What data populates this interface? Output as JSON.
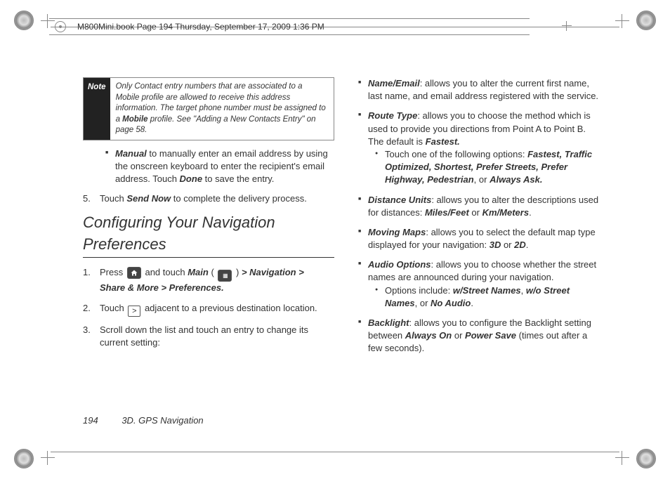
{
  "header": "M800Mini.book  Page 194  Thursday, September 17, 2009  1:36 PM",
  "note": {
    "label": "Note",
    "body_pre": "Only Contact entry numbers that are associated to a Mobile profile are allowed to receive this address information. The target phone number must be assigned to a ",
    "body_strong": "Mobile",
    "body_post": " profile. See \"Adding a New Contacts Entry\" on page 58."
  },
  "manual": {
    "label": "Manual",
    "text": " to manually enter an email address by using the onscreen keyboard to enter the recipient's email address. Touch ",
    "done": "Done",
    "text2": " to save the entry."
  },
  "step5": {
    "num": "5.",
    "pre": "Touch ",
    "bold": "Send Now",
    "post": " to complete the delivery process."
  },
  "sectionTitle": "Configuring Your Navigation Preferences",
  "step1": {
    "num": "1.",
    "p1": "Press ",
    "p2": " and touch ",
    "main": "Main",
    "paren_open": " ( ",
    "paren_close": " ) ",
    "gt1": ">",
    "nav": "Navigation",
    "gt2": ">",
    "share": "Share & More",
    "gt3": ">",
    "prefs": "Preferences."
  },
  "step2": {
    "num": "2.",
    "pre": "Touch ",
    "post": " adjacent to a previous destination location."
  },
  "step3": {
    "num": "3.",
    "text": "  Scroll down the list and touch an entry to change its current setting:"
  },
  "opts": {
    "name_email": {
      "label": "Name/Email",
      "text": ": allows you to alter the current first name, last name, and email address registered with the service."
    },
    "route": {
      "label": "Route Type",
      "text": ": allows you to choose the method which is used to provide you directions from Point A to Point B. The default is ",
      "def": "Fastest."
    },
    "route_bullet_pre": "Touch one of the following options: ",
    "route_opts": "Fastest, Traffic Optimized, Shortest, Prefer Streets, Prefer Highway, Pedestrian",
    "route_or": ", or ",
    "route_last": "Always Ask.",
    "distance": {
      "label": "Distance Units",
      "text": ": allows you to alter the descriptions used for distances: ",
      "o1": "Miles/Feet",
      "or": " or ",
      "o2": "Km/Meters"
    },
    "maps": {
      "label": "Moving Maps",
      "text": ": allows you to select the default map type displayed for your navigation: ",
      "o1": "3D",
      "or": " or ",
      "o2": "2D"
    },
    "audio": {
      "label": "Audio Options",
      "text": ": allows you to choose whether the street names are announced during your navigation."
    },
    "audio_bullet_pre": "Options include: ",
    "audio_o1": "w/Street Names",
    "audio_o2": "w/o Street Names",
    "audio_or2": ", or ",
    "audio_o3": "No Audio",
    "backlight": {
      "label": "Backlight",
      "text": ": allows you to configure the Backlight setting between ",
      "o1": "Always On",
      "or": " or ",
      "o2": "Power Save",
      "post": " (times out after a few seconds)."
    }
  },
  "footer": {
    "page": "194",
    "section": "3D. GPS Navigation"
  }
}
